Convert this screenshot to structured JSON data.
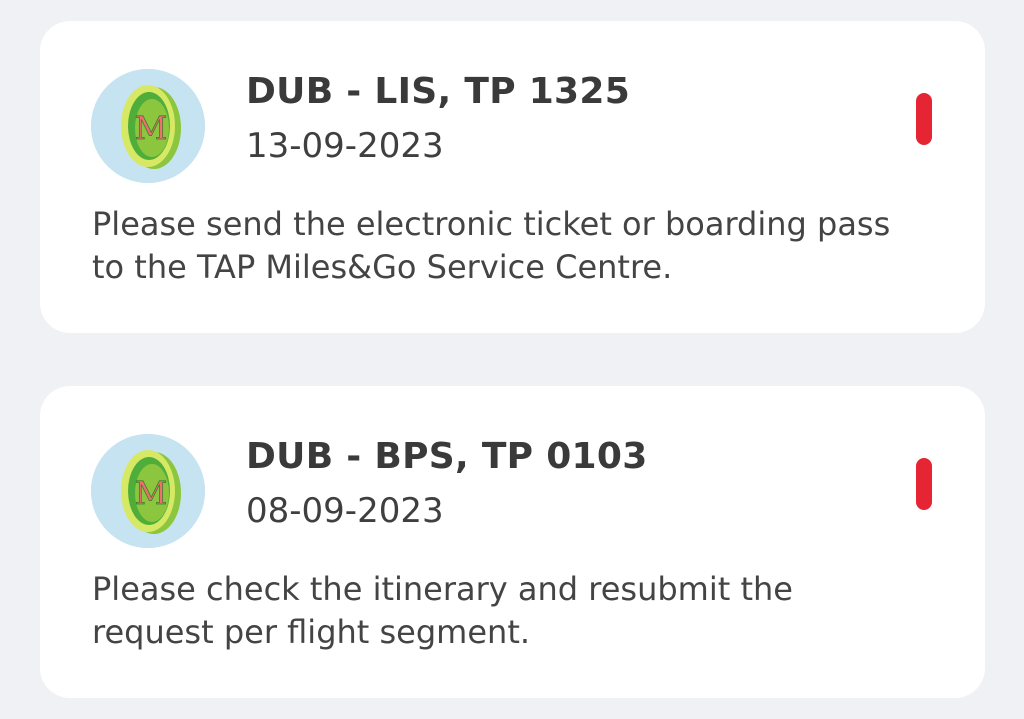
{
  "requests": [
    {
      "title": "DUB - LIS, TP 1325",
      "date": "13-09-2023",
      "message": "Please send the electronic ticket or boarding pass to the TAP Miles&Go Service Centre.",
      "badge_letter": "M",
      "badge_icon": "miles-coin-icon",
      "status_color": "#e52533"
    },
    {
      "title": "DUB - BPS, TP 0103",
      "date": "08-09-2023",
      "message": "Please check the itinerary and resubmit the request per flight segment.",
      "badge_letter": "M",
      "badge_icon": "miles-coin-icon",
      "status_color": "#e52533"
    }
  ]
}
